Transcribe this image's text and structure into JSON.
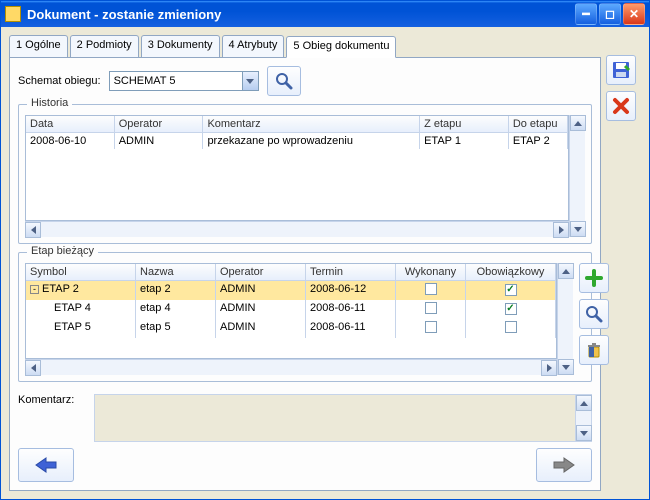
{
  "window": {
    "title": "Dokument - zostanie zmieniony"
  },
  "tabs": [
    {
      "label": "1 Ogólne"
    },
    {
      "label": "2 Podmioty"
    },
    {
      "label": "3 Dokumenty"
    },
    {
      "label": "4 Atrybuty"
    },
    {
      "label": "5 Obieg dokumentu"
    }
  ],
  "schemat": {
    "label": "Schemat obiegu:",
    "value": "SCHEMAT 5"
  },
  "historia": {
    "legend": "Historia",
    "cols": [
      "Data",
      "Operator",
      "Komentarz",
      "Z etapu",
      "Do etapu"
    ],
    "rows": [
      {
        "data": "2008-06-10",
        "operator": "ADMIN",
        "komentarz": "przekazane po wprowadzeniu",
        "zetapu": "ETAP 1",
        "doetapu": "ETAP 2"
      }
    ]
  },
  "etap": {
    "legend": "Etap bieżący",
    "cols": [
      "Symbol",
      "Nazwa",
      "Operator",
      "Termin",
      "Wykonany",
      "Obowiązkowy"
    ],
    "rows": [
      {
        "symbol": "ETAP 2",
        "nazwa": "etap 2",
        "operator": "ADMIN",
        "termin": "2008-06-12",
        "wykonany": false,
        "obowiazkowy": true,
        "level": 0,
        "selected": true,
        "expand": "-"
      },
      {
        "symbol": "ETAP 4",
        "nazwa": "etap 4",
        "operator": "ADMIN",
        "termin": "2008-06-11",
        "wykonany": false,
        "obowiazkowy": true,
        "level": 1
      },
      {
        "symbol": "ETAP 5",
        "nazwa": "etap 5",
        "operator": "ADMIN",
        "termin": "2008-06-11",
        "wykonany": false,
        "obowiazkowy": false,
        "level": 1
      }
    ]
  },
  "komentarz": {
    "label": "Komentarz:"
  },
  "icons": {
    "search": "search-icon",
    "save": "save-disk-icon",
    "cancel": "cancel-x-icon",
    "add": "plus-icon",
    "delete": "trash-icon",
    "back": "arrow-left-icon",
    "forward": "arrow-right-icon"
  }
}
